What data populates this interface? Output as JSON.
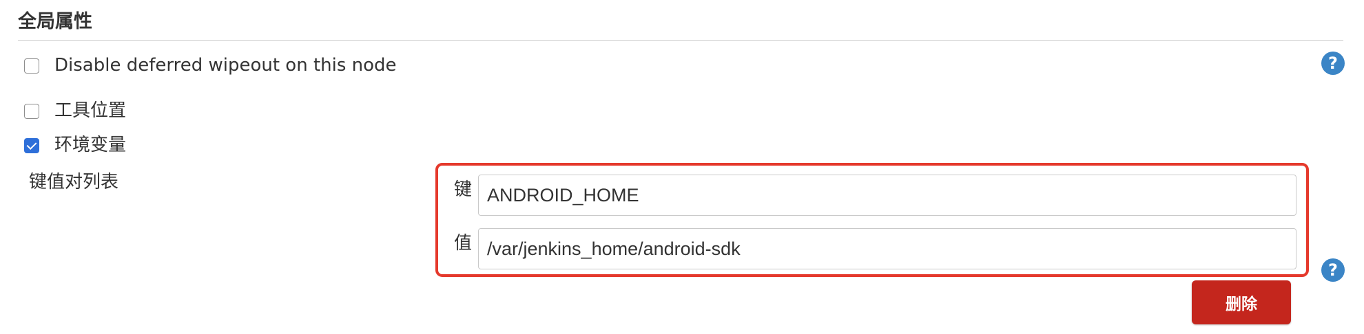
{
  "section": {
    "title": "全局属性"
  },
  "options": [
    {
      "label": "Disable deferred wipeout on this node",
      "checked": false
    },
    {
      "label": "工具位置",
      "checked": false
    },
    {
      "label": "环境变量",
      "checked": true
    }
  ],
  "env_vars": {
    "list_label": "键值对列表",
    "key_label": "键",
    "value_label": "值",
    "key_value": "ANDROID_HOME",
    "value_value": "/var/jenkins_home/android-sdk",
    "delete_label": "删除"
  },
  "help": {
    "glyph": "?"
  },
  "colors": {
    "accent": "#3b85c6",
    "checkbox_checked": "#2e6fd9",
    "highlight": "#e5392c",
    "delete_button": "#c4261d"
  }
}
